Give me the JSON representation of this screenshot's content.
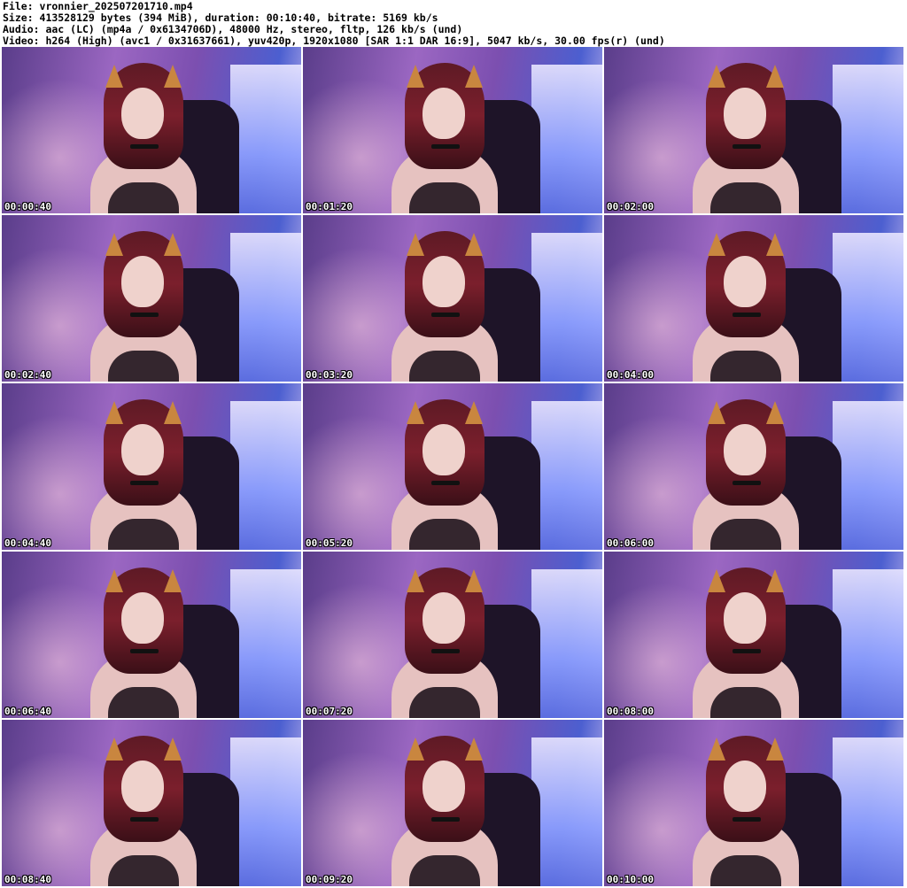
{
  "header": {
    "file": "File: vronnier_202507201710.mp4",
    "size": "Size: 413528129 bytes (394 MiB), duration: 00:10:40, bitrate: 5169 kb/s",
    "audio": "Audio: aac (LC) (mp4a / 0x6134706D), 48000 Hz, stereo, fltp, 126 kb/s (und)",
    "video": "Video: h264 (High) (avc1 / 0x31637661), yuv420p, 1920x1080 [SAR 1:1 DAR 16:9], 5047 kb/s, 30.00 fps(r) (und)"
  },
  "thumbnails": [
    {
      "timestamp": "00:00:40"
    },
    {
      "timestamp": "00:01:20"
    },
    {
      "timestamp": "00:02:00"
    },
    {
      "timestamp": "00:02:40"
    },
    {
      "timestamp": "00:03:20"
    },
    {
      "timestamp": "00:04:00"
    },
    {
      "timestamp": "00:04:40"
    },
    {
      "timestamp": "00:05:20"
    },
    {
      "timestamp": "00:06:00"
    },
    {
      "timestamp": "00:06:40"
    },
    {
      "timestamp": "00:07:20"
    },
    {
      "timestamp": "00:08:00"
    },
    {
      "timestamp": "00:08:40"
    },
    {
      "timestamp": "00:09:20"
    },
    {
      "timestamp": "00:10:00"
    }
  ]
}
